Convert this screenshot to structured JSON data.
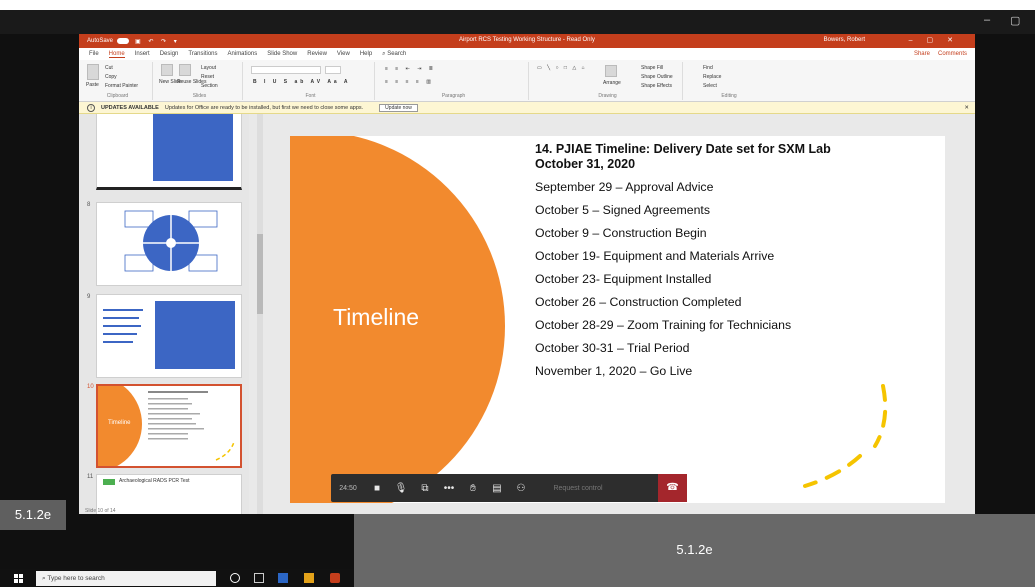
{
  "window_title": "Airport RCS Testing Working Structure - Read Only",
  "ribbon_tabs": [
    "File",
    "Home",
    "Insert",
    "Design",
    "Transitions",
    "Animations",
    "Slide Show",
    "Review",
    "View",
    "Help",
    "Search"
  ],
  "ribbon_right": [
    "Share",
    "Comments"
  ],
  "user_name": "Bowers, Robert",
  "autosave_label": "AutoSave",
  "ribbon_groups": [
    "Clipboard",
    "Slides",
    "Font",
    "Paragraph",
    "Drawing",
    "Editing"
  ],
  "ribbon_buttons": {
    "paste": "Paste",
    "cut": "Cut",
    "copy": "Copy",
    "format_painter": "Format Painter",
    "new_slide": "New Slide",
    "reuse_slides": "Reuse Slides",
    "layout": "Layout",
    "reset": "Reset",
    "section": "Section",
    "arrange": "Arrange",
    "quick_styles": "Quick Styles",
    "shape_fill": "Shape Fill",
    "shape_outline": "Shape Outline",
    "shape_effects": "Shape Effects",
    "find": "Find",
    "replace": "Replace",
    "select": "Select"
  },
  "notification": {
    "title": "UPDATES AVAILABLE",
    "text": "Updates for Office are ready to be installed, but first we need to close some apps.",
    "button": "Update now"
  },
  "thumbnails": [
    {
      "num": "8"
    },
    {
      "num": "9"
    },
    {
      "num": "10",
      "label": "Timeline"
    },
    {
      "num": "11",
      "title": "Archaeological RADS PCR Test"
    }
  ],
  "slide": {
    "title_line1": "14.   PJIAE Timeline: Delivery Date set for SXM Lab",
    "title_line2": "October 31, 2020",
    "items": [
      "September 29 – Approval Advice",
      "October 5 – Signed Agreements",
      "October 9 – Construction Begin",
      "October 19- Equipment and Materials Arrive",
      "October 23- Equipment Installed",
      "October 26 – Construction Completed",
      "October 28-29  – Zoom Training for Technicians",
      "October 30-31 – Trial Period",
      "November 1, 2020 – Go Live"
    ],
    "circle_label": "Timeline",
    "accent_color": "#f28a2e",
    "dash_color": "#f5c400"
  },
  "meeting": {
    "time": "24:50",
    "request_control": "Request control"
  },
  "status_bar": "Slide 10 of 14",
  "overlay_label_left": "5.1.2e",
  "overlay_label_center": "5.1.2e",
  "taskbar": {
    "search_placeholder": "Type here to search"
  }
}
